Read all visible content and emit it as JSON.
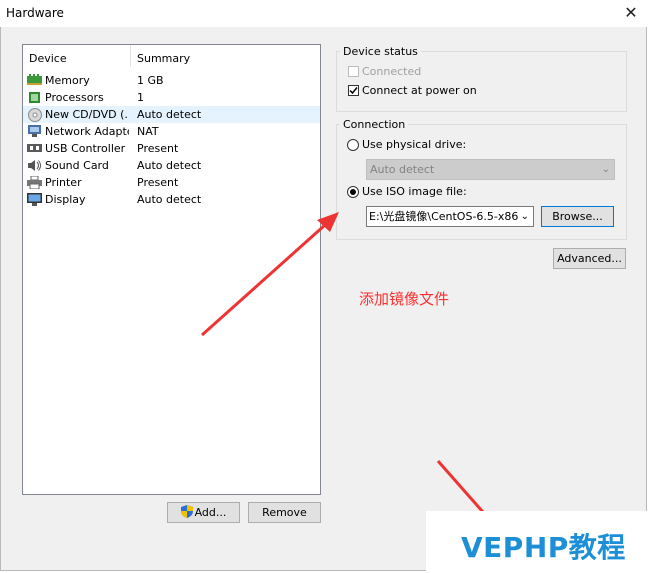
{
  "window": {
    "title": "Hardware",
    "close_glyph": "✕"
  },
  "device_list": {
    "headers": {
      "device": "Device",
      "summary": "Summary"
    },
    "rows": [
      {
        "icon": "memory-icon",
        "device": "Memory",
        "summary": "1 GB"
      },
      {
        "icon": "processor-icon",
        "device": "Processors",
        "summary": "1"
      },
      {
        "icon": "cd-dvd-icon",
        "device": "New CD/DVD (...",
        "summary": "Auto detect",
        "selected": true
      },
      {
        "icon": "network-adapter-icon",
        "device": "Network Adapter",
        "summary": "NAT"
      },
      {
        "icon": "usb-icon",
        "device": "USB Controller",
        "summary": "Present"
      },
      {
        "icon": "sound-card-icon",
        "device": "Sound Card",
        "summary": "Auto detect"
      },
      {
        "icon": "printer-icon",
        "device": "Printer",
        "summary": "Present"
      },
      {
        "icon": "display-icon",
        "device": "Display",
        "summary": "Auto detect"
      }
    ],
    "add_label": "Add...",
    "remove_label": "Remove"
  },
  "device_status": {
    "label": "Device status",
    "connected_label": "Connected",
    "connected_checked": false,
    "connected_disabled": true,
    "connect_at_power_on_label": "Connect at power on",
    "connect_at_power_on_checked": true
  },
  "connection": {
    "label": "Connection",
    "physical_drive_label": "Use physical drive:",
    "physical_drive_selected": false,
    "physical_drive_value": "Auto detect",
    "iso_label": "Use ISO image file:",
    "iso_selected": true,
    "iso_path": "E:\\光盘镜像\\CentOS-6.5-x86",
    "browse_label": "Browse..."
  },
  "advanced_label": "Advanced...",
  "annotation_text": "添加镜像文件",
  "watermark": "VEPHP教程",
  "colors": {
    "annotation": "#ff3030",
    "watermark": "#1c8fd6",
    "selected_row": "#e5f3ff",
    "arrow": "#ee3333"
  }
}
